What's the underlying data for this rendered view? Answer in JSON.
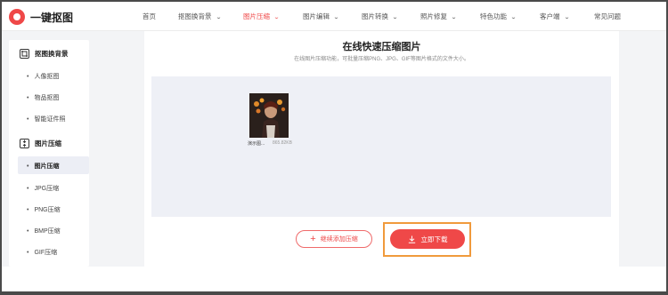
{
  "brand": {
    "name": "一键抠图"
  },
  "nav": [
    {
      "label": "首页",
      "dropdown": false
    },
    {
      "label": "抠图换背景",
      "dropdown": true
    },
    {
      "label": "图片压缩",
      "dropdown": true,
      "active": true
    },
    {
      "label": "图片编辑",
      "dropdown": true
    },
    {
      "label": "图片转换",
      "dropdown": true
    },
    {
      "label": "照片修复",
      "dropdown": true
    },
    {
      "label": "特色功能",
      "dropdown": true
    },
    {
      "label": "客户端",
      "dropdown": true
    },
    {
      "label": "常见问题",
      "dropdown": false
    }
  ],
  "sidebar": {
    "section1": {
      "title": "抠图换背景",
      "icon": "crop-icon"
    },
    "section1_items": [
      "人像抠图",
      "物品抠图",
      "智能证件照"
    ],
    "section2": {
      "title": "图片压缩",
      "icon": "compress-icon"
    },
    "section2_items": [
      "图片压缩",
      "JPG压缩",
      "PNG压缩",
      "BMP压缩",
      "GIF压缩"
    ]
  },
  "main": {
    "title": "在线快速压缩图片",
    "subtitle": "在线图片压缩功能，可批量压缩PNG、JPG、GIF等图片格式的文件大小。",
    "file": {
      "name": "演示图...",
      "size": "865.82KB"
    },
    "add_button": "继续添加压缩",
    "download_button": "立即下载"
  },
  "colors": {
    "accent": "#ef4848",
    "highlight": "#f09a3c"
  }
}
